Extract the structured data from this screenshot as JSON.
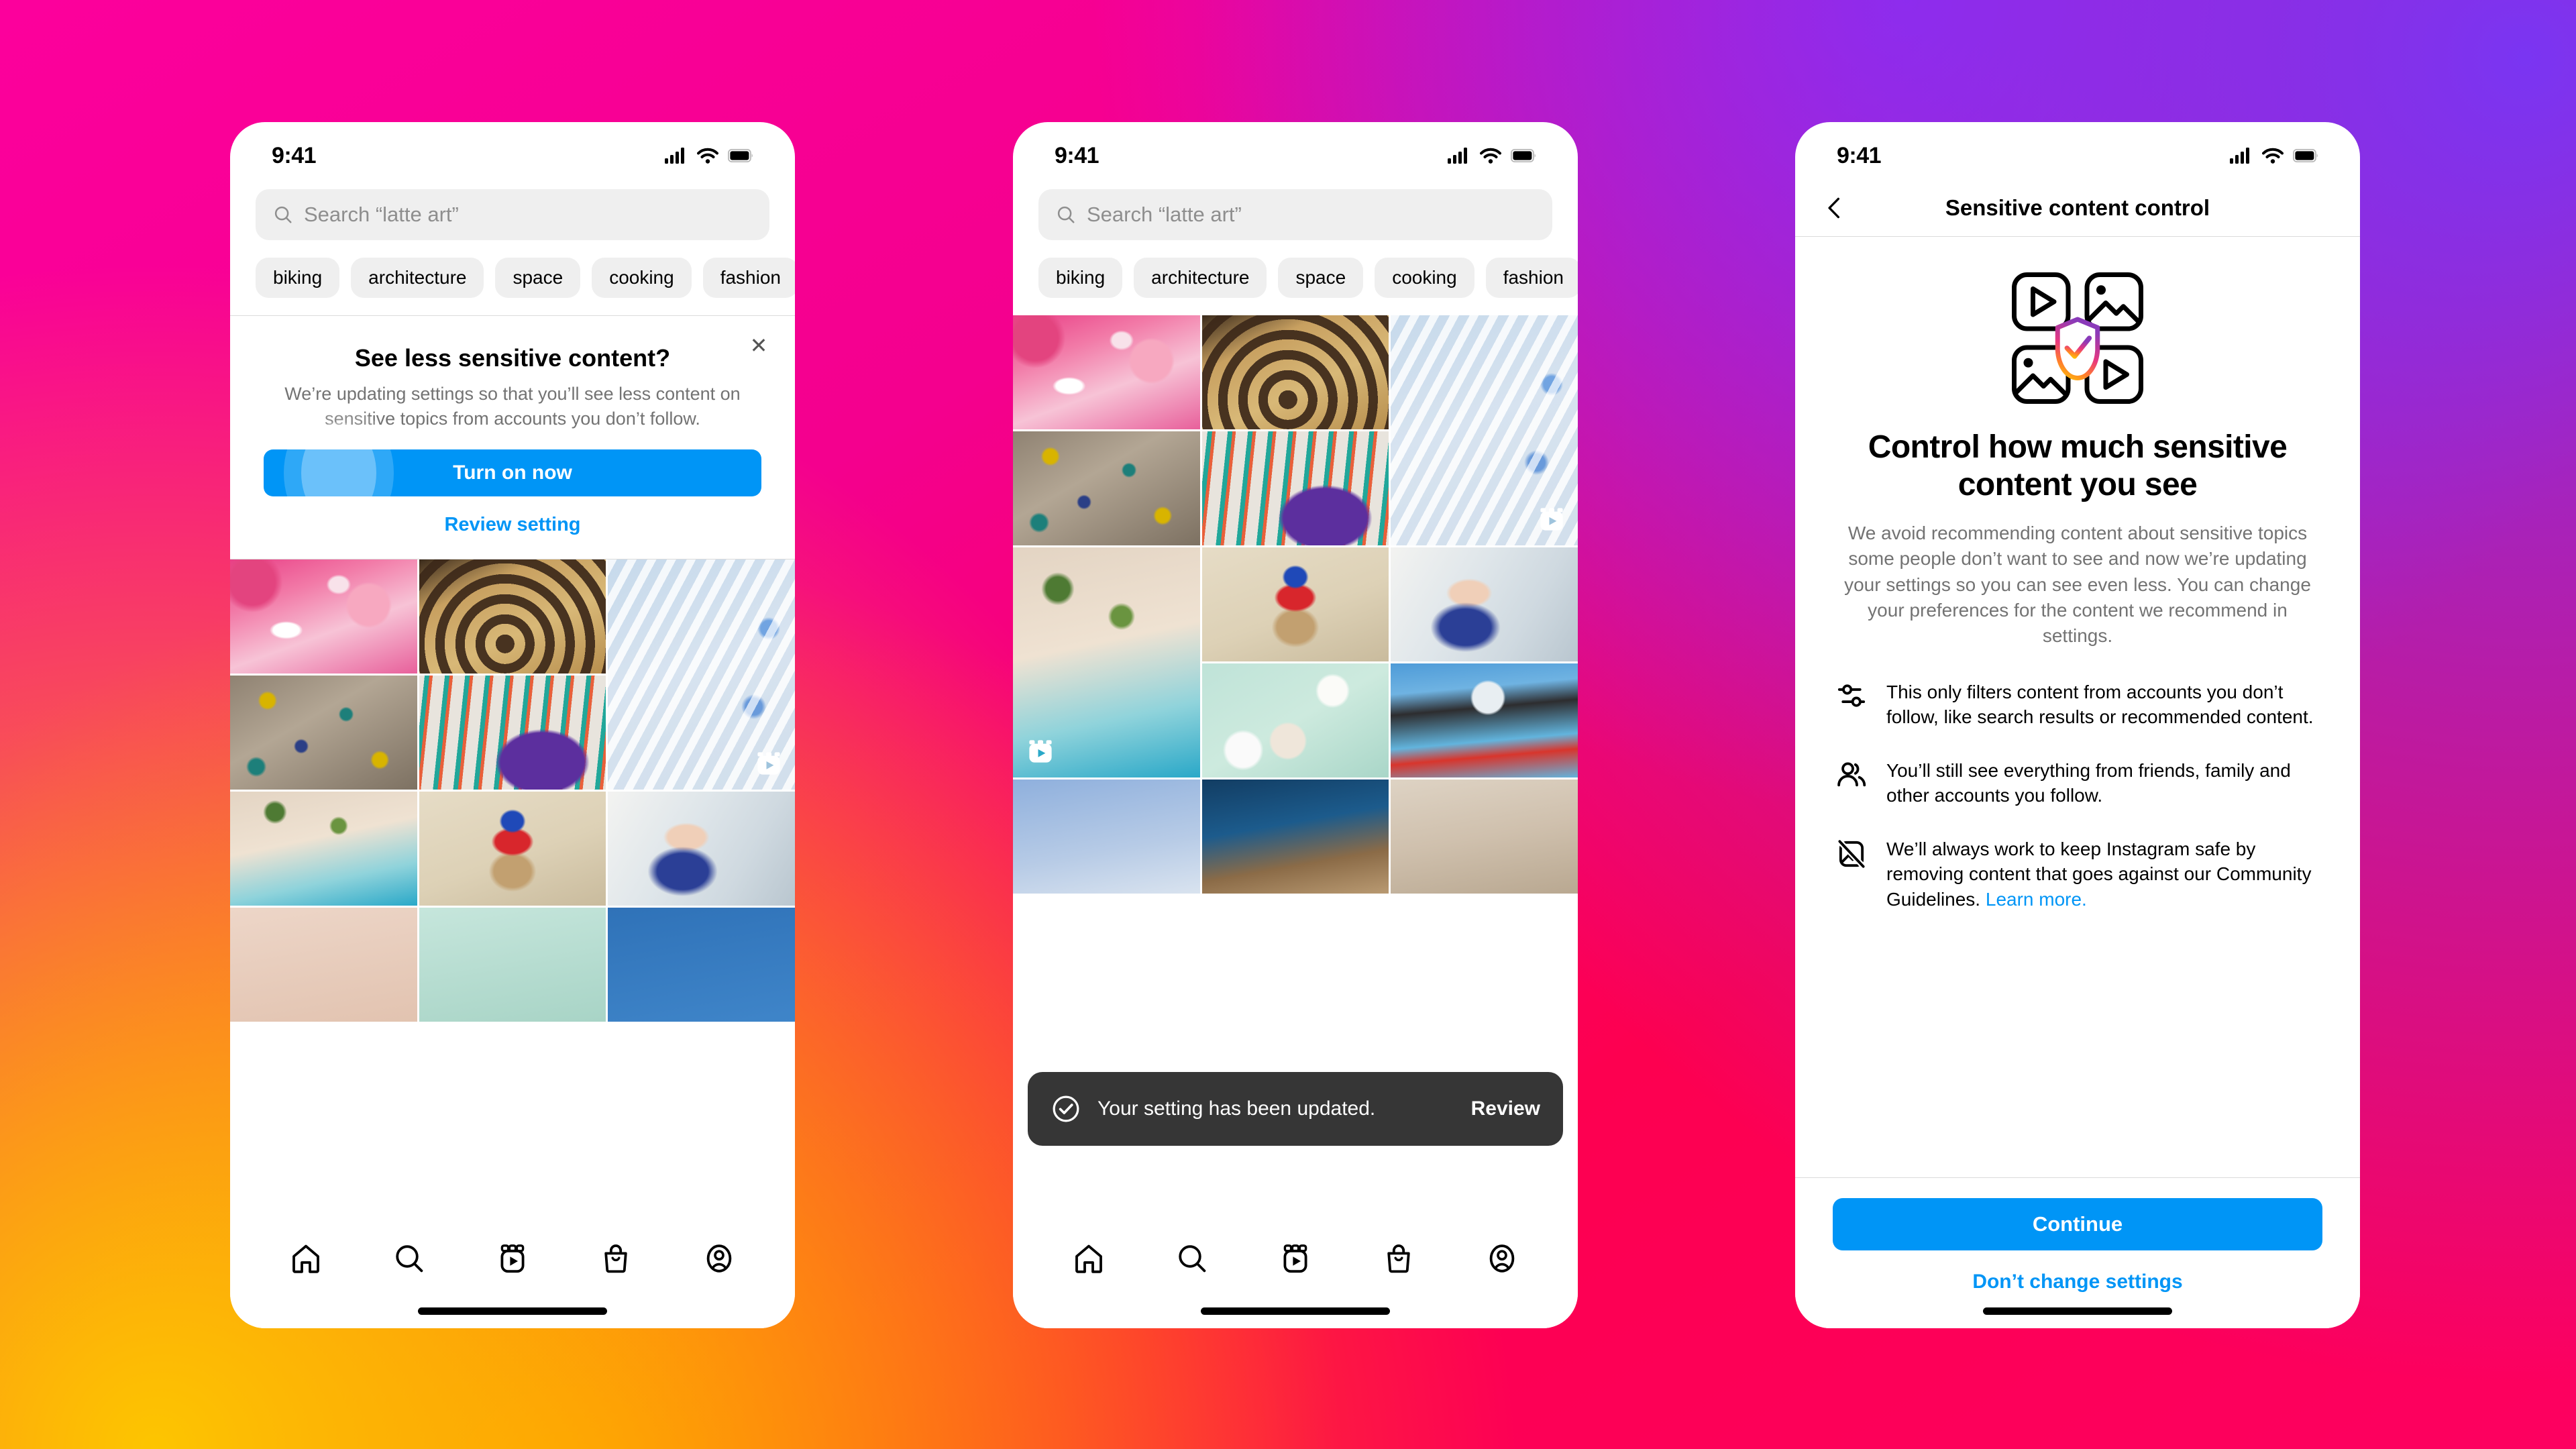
{
  "background": {
    "gradient_colors": [
      "#FC009C",
      "#7A35F2",
      "#FD0060",
      "#FDC500",
      "#FF7A00"
    ]
  },
  "accent_color": "#0095F6",
  "status_bar": {
    "time": "9:41"
  },
  "phone1": {
    "search": {
      "placeholder": "Search “latte art”",
      "icon": "search-icon"
    },
    "chips": [
      "biking",
      "architecture",
      "space",
      "cooking",
      "fashion"
    ],
    "banner": {
      "title": "See less sensitive content?",
      "body": "We’re updating settings so that you’ll see less content on sensitive topics from accounts you don’t follow.",
      "primary_label": "Turn on now",
      "link_label": "Review setting",
      "close_icon": "close-icon"
    },
    "tabs": [
      {
        "name": "home",
        "icon": "home-icon"
      },
      {
        "name": "search",
        "icon": "search-icon"
      },
      {
        "name": "reels",
        "icon": "reels-icon"
      },
      {
        "name": "shop",
        "icon": "shop-icon"
      },
      {
        "name": "profile",
        "icon": "profile-icon"
      }
    ]
  },
  "phone2": {
    "search": {
      "placeholder": "Search “latte art”",
      "icon": "search-icon"
    },
    "chips": [
      "biking",
      "architecture",
      "space",
      "cooking",
      "fashion"
    ],
    "toast": {
      "icon": "check-circle-icon",
      "message": "Your setting has been updated.",
      "action_label": "Review"
    },
    "tabs": [
      {
        "name": "home",
        "icon": "home-icon"
      },
      {
        "name": "search",
        "icon": "search-icon"
      },
      {
        "name": "reels",
        "icon": "reels-icon"
      },
      {
        "name": "shop",
        "icon": "shop-icon"
      },
      {
        "name": "profile",
        "icon": "profile-icon"
      }
    ]
  },
  "phone3": {
    "nav": {
      "back_icon": "chevron-left-icon",
      "title": "Sensitive content control"
    },
    "illustration": "shield-check-media-grid-illustration",
    "heading": "Control how much sensitive content you see",
    "paragraph": "We avoid recommending content about sensitive topics some people don’t want to see and now we’re updating your settings so you can see even less. You can change your preferences for the content we recommend in settings.",
    "bullets": [
      {
        "icon": "sliders-icon",
        "text": "This only filters content from accounts you don’t follow, like search results or recommended content."
      },
      {
        "icon": "people-icon",
        "text": "You’ll still see everything from friends, family and other accounts you follow."
      },
      {
        "icon": "image-off-icon",
        "text": "We’ll always work to keep Instagram safe by removing content that goes against our Community Guidelines. ",
        "link_text": "Learn more."
      }
    ],
    "primary_label": "Continue",
    "secondary_label": "Don’t change settings"
  }
}
